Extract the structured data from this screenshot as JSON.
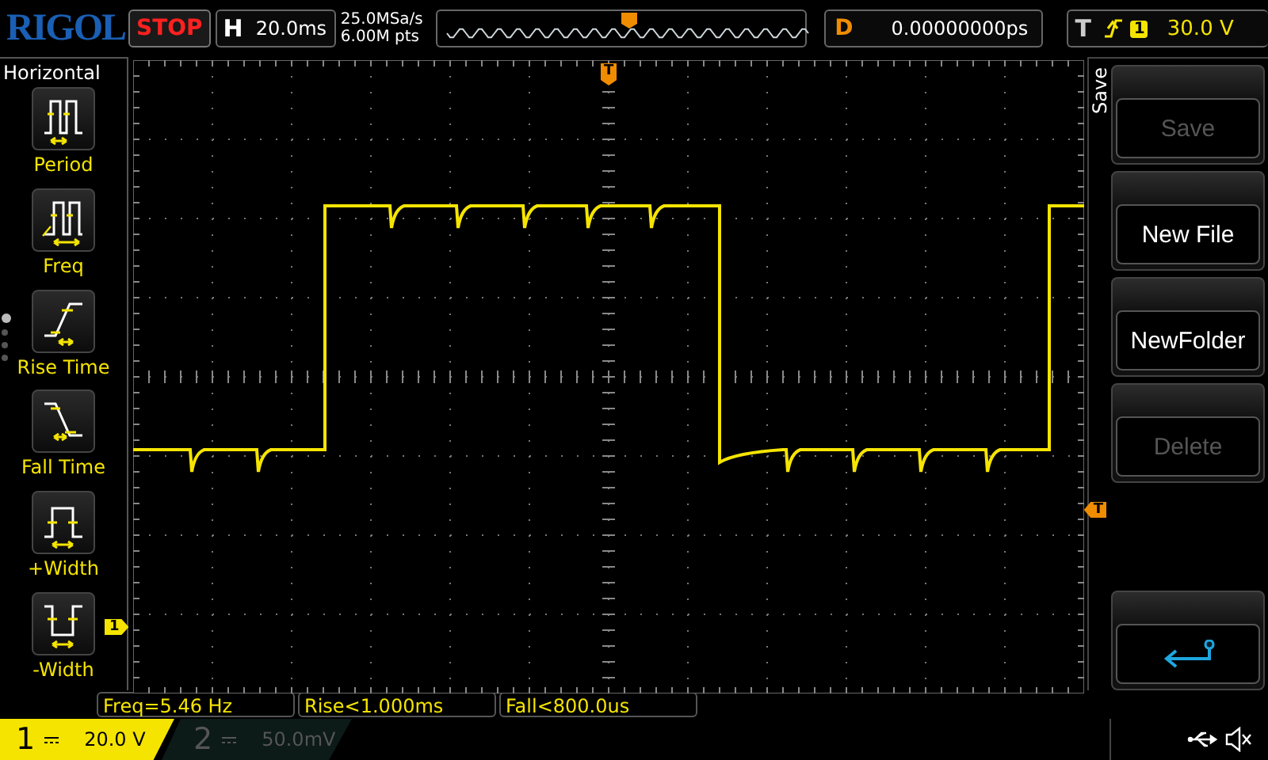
{
  "top_bar": {
    "logo": "RIGOL",
    "run_state": "STOP",
    "timebase_label": "H",
    "timebase": "20.0ms",
    "sample_rate": "25.0MSa/s",
    "memory_depth": "6.00M pts",
    "delay_label": "D",
    "delay": "0.00000000ps",
    "trigger_label": "T",
    "trigger_source": "1",
    "trigger_level": "30.0 V"
  },
  "left_panel": {
    "title": "Horizontal",
    "page_dots": [
      {
        "selected": true
      },
      {
        "selected": false
      },
      {
        "selected": false
      },
      {
        "selected": false
      }
    ],
    "items": [
      {
        "kind": "period",
        "label": "Period"
      },
      {
        "kind": "freq",
        "label": "Freq"
      },
      {
        "kind": "rise",
        "label": "Rise Time"
      },
      {
        "kind": "fall",
        "label": "Fall Time"
      },
      {
        "kind": "pwidth",
        "label": "+Width"
      },
      {
        "kind": "nwidth",
        "label": "-Width"
      }
    ]
  },
  "screen": {
    "trigger_position_marker": "T",
    "trigger_level_marker": "T",
    "channel_marker": "1"
  },
  "right_menu": {
    "title": "Save",
    "buttons": [
      {
        "kind": "text",
        "label": "Save",
        "disabled": true
      },
      {
        "kind": "text",
        "label": "New File",
        "disabled": false
      },
      {
        "kind": "text",
        "label": "NewFolder",
        "disabled": false
      },
      {
        "kind": "text",
        "label": "Delete",
        "disabled": true
      },
      {
        "kind": "return"
      }
    ]
  },
  "measurements": [
    "Freq=5.46 Hz",
    "Rise<1.000ms",
    "Fall<800.0us"
  ],
  "channels": [
    {
      "number": "1",
      "scale": "20.0 V",
      "active": true
    },
    {
      "number": "2",
      "scale": "50.0mV",
      "active": false
    }
  ]
}
